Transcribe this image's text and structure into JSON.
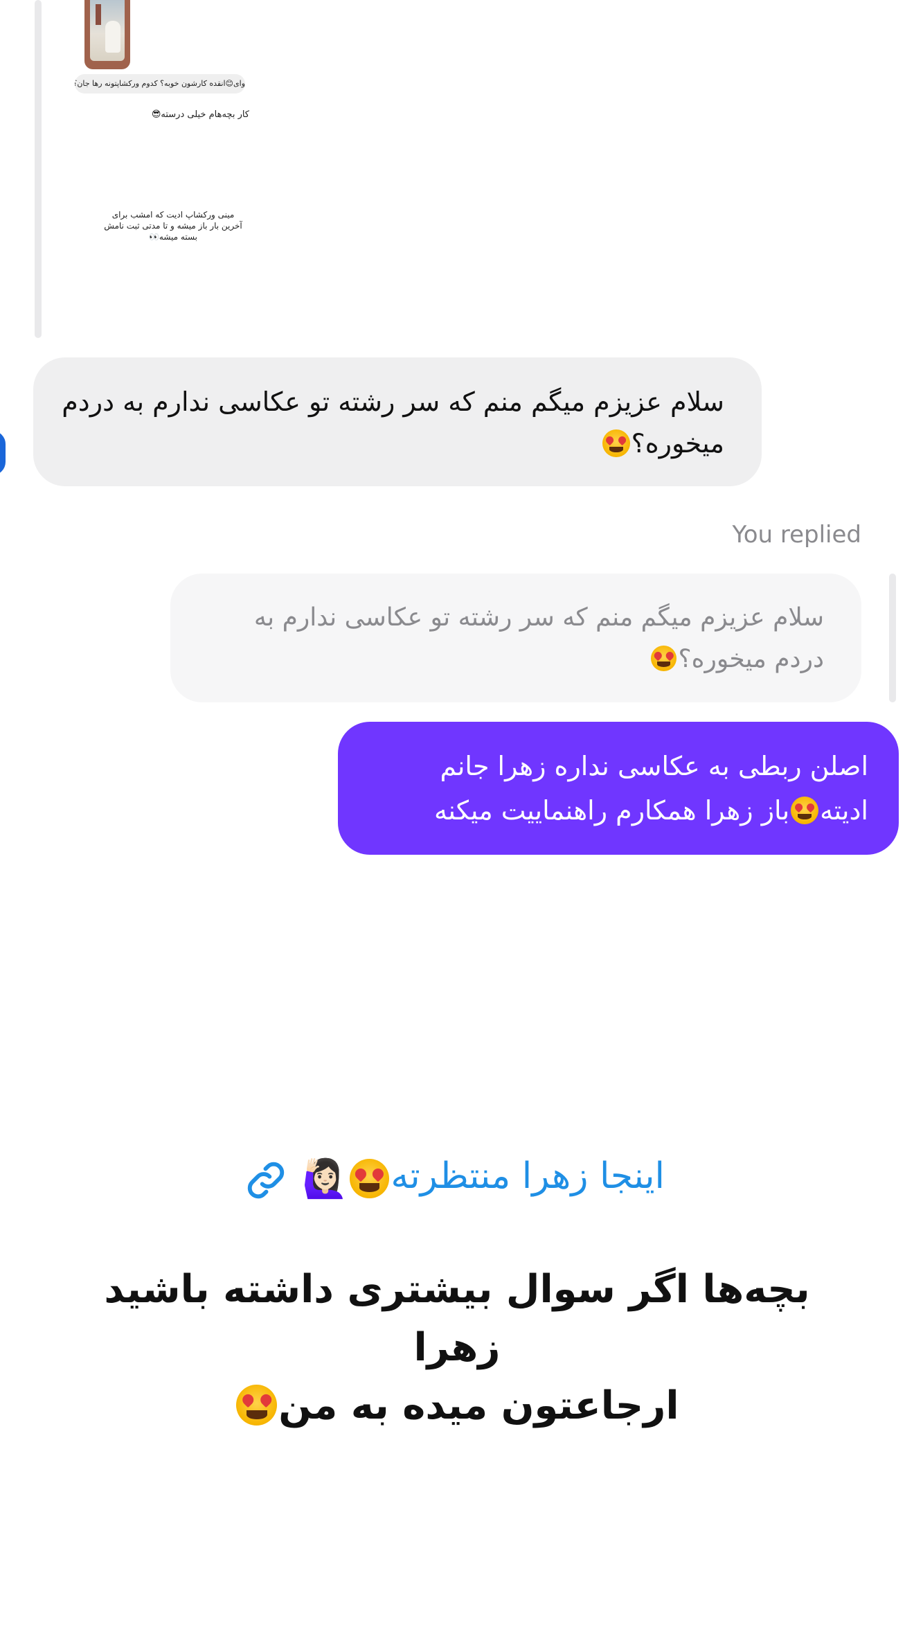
{
  "story": {
    "pill_text": "وای😊انقده کارشون خوبه؟ کدوم ورکشاپتونه رها جان؟",
    "line2": "کار بچه‌هام خیلی درسته😎",
    "line3": "مینی ورکشاپ ادیت که امشب برای آخرین بار باز میشه و تا مدتی ثبت نامش بسته میشه👀"
  },
  "incoming_message": {
    "text": "سلام عزیزم  میگم منم که سر رشته تو عکاسی ندارم به دردم میخوره؟",
    "emoji": "heart-eyes-emoji"
  },
  "reply_label": "You replied",
  "quoted_message": {
    "text": "سلام عزیزم  میگم منم که سر رشته تو عکاسی ندارم به دردم میخوره؟",
    "emoji": "heart-eyes-emoji"
  },
  "outgoing_message": {
    "line1": "اصلن ربطی به عکاسی نداره زهرا جانم",
    "line2_prefix": "ادیته",
    "line2_suffix": "باز زهرا همکارم راهنماییت میکنه"
  },
  "link": {
    "text": "اینجا زهرا منتظرته",
    "gesture_emoji": "🙋🏻‍♀️",
    "icon": "link-icon",
    "color": "#1f8fe5"
  },
  "caption": {
    "line1": "بچه‌ها اگر سوال بیشتری داشته باشید زهرا",
    "line2": "ارجاعتون میده به من"
  },
  "colors": {
    "outgoing_bubble": "#7036ff",
    "incoming_bubble": "#efeff0",
    "quoted_bubble": "#f6f6f7"
  }
}
